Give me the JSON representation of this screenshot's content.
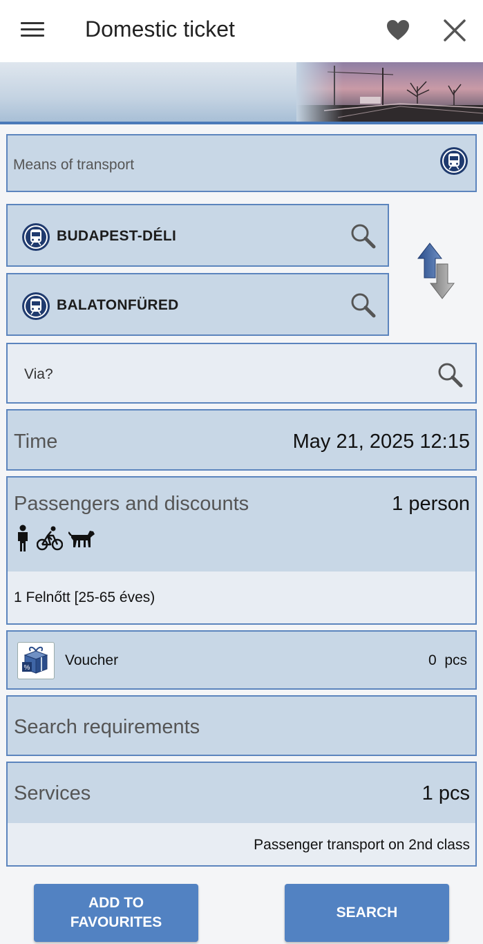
{
  "header": {
    "title": "Domestic ticket",
    "menu_icon": "hamburger-menu-icon",
    "favourite_icon": "heart-icon",
    "close_icon": "close-icon"
  },
  "colors": {
    "card_bg": "#c8d7e6",
    "card_border": "#5b84bd",
    "button_bg": "#5282c2",
    "banner_accent": "#4a79b8"
  },
  "form": {
    "means_of_transport": {
      "label": "Means of transport",
      "icon": "train-icon"
    },
    "from_station": {
      "name": "BUDAPEST-DÉLI",
      "icon": "train-icon",
      "search_icon": "magnifier-icon"
    },
    "to_station": {
      "name": "BALATONFÜRED",
      "icon": "train-icon",
      "search_icon": "magnifier-icon"
    },
    "swap_icon": "swap-arrows-icon",
    "via": {
      "placeholder": "Via?",
      "search_icon": "magnifier-icon"
    },
    "time": {
      "label": "Time",
      "value": "May 21, 2025 12:15"
    },
    "passengers": {
      "label": "Passengers and discounts",
      "count": "1 person",
      "icons": [
        "person-icon",
        "bicycle-icon",
        "dog-icon"
      ],
      "detail": "1 Felnőtt [25-65 éves)"
    },
    "voucher": {
      "label": "Voucher",
      "quantity": "0  pcs",
      "icon": "gift-voucher-icon"
    },
    "search_requirements": {
      "label": "Search requirements"
    },
    "services": {
      "label": "Services",
      "count": "1 pcs",
      "detail": "Passenger transport on 2nd class"
    }
  },
  "actions": {
    "add_to_favourites": "ADD TO\nFAVOURITES",
    "search": "SEARCH"
  }
}
